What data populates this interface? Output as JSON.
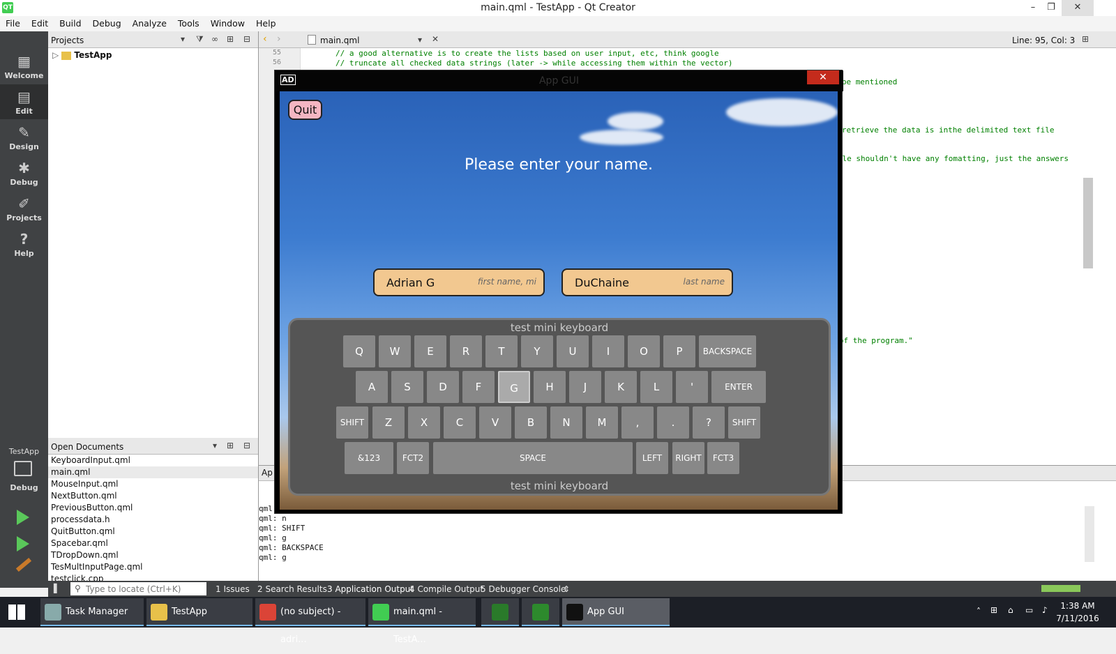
{
  "window": {
    "title": "main.qml - TestApp - Qt Creator",
    "logo": "QT"
  },
  "menu": [
    "File",
    "Edit",
    "Build",
    "Debug",
    "Analyze",
    "Tools",
    "Window",
    "Help"
  ],
  "modes": [
    {
      "label": "Welcome",
      "icon": "grid-icon"
    },
    {
      "label": "Edit",
      "icon": "document-icon"
    },
    {
      "label": "Design",
      "icon": "pen-icon"
    },
    {
      "label": "Debug",
      "icon": "bug-icon"
    },
    {
      "label": "Projects",
      "icon": "wrench-icon"
    },
    {
      "label": "Help",
      "icon": "help-icon"
    }
  ],
  "kit": {
    "project": "TestApp",
    "mode": "Debug"
  },
  "projects": {
    "header": "Projects",
    "tree_root": "TestApp"
  },
  "open_docs": {
    "header": "Open Documents",
    "files": [
      "KeyboardInput.qml",
      "main.qml",
      "MouseInput.qml",
      "NextButton.qml",
      "PreviousButton.qml",
      "processdata.h",
      "QuitButton.qml",
      "Spacebar.qml",
      "TDropDown.qml",
      "TesMultInputPage.qml",
      "testclick.cpp"
    ],
    "selected": "main.qml"
  },
  "editor": {
    "file": "main.qml",
    "position": "Line: 95, Col: 3",
    "lines": [
      {
        "n": "55",
        "code": "// a good alternative is to create the lists based on user input, etc, think google"
      },
      {
        "n": "56",
        "code": "// truncate all checked data strings (later -> while accessing them within the vector)"
      }
    ],
    "visible_fragments": [
      "to be mentioned",
      "to retrieve the data is inthe delimited text file",
      ": file shouldn't have any fomatting, just the answers",
      "ng of the program.\""
    ]
  },
  "output": {
    "header": "Ap",
    "lines": [
      "qml: a",
      "qml: n",
      "qml: SHIFT",
      "qml: g",
      "qml: BACKSPACE",
      "qml: g"
    ]
  },
  "statusbar": {
    "locate_placeholder": "Type to locate (Ctrl+K)",
    "tabs": [
      "1  Issues",
      "2  Search Results",
      "3  Application Output",
      "4  Compile Output",
      "5  Debugger Console"
    ]
  },
  "app": {
    "logo": "AD",
    "title": "App GUI",
    "quit": "Quit",
    "prompt": "Please enter your name.",
    "first_name": {
      "value": "Adrian G",
      "placeholder": "first name, mi"
    },
    "last_name": {
      "value": "DuChaine",
      "placeholder": "last name"
    },
    "keyboard_title": "test mini keyboard",
    "rows": [
      [
        "Q",
        "W",
        "E",
        "R",
        "T",
        "Y",
        "U",
        "I",
        "O",
        "P",
        "BACKSPACE"
      ],
      [
        "A",
        "S",
        "D",
        "F",
        "G",
        "H",
        "J",
        "K",
        "L",
        "'",
        "ENTER"
      ],
      [
        "SHIFT",
        "Z",
        "X",
        "C",
        "V",
        "B",
        "N",
        "M",
        ",",
        ".",
        "?",
        "SHIFT"
      ],
      [
        "&123",
        "FCT2",
        "SPACE",
        "LEFT",
        "RIGHT",
        "FCT3"
      ]
    ],
    "pressed_key": "G"
  },
  "taskbar": {
    "items": [
      "Task Manager",
      "TestApp",
      "(no subject) - adri...",
      "main.qml - TestA...",
      "",
      "",
      "App GUI"
    ],
    "time": "1:38 AM",
    "date": "7/11/2016"
  }
}
